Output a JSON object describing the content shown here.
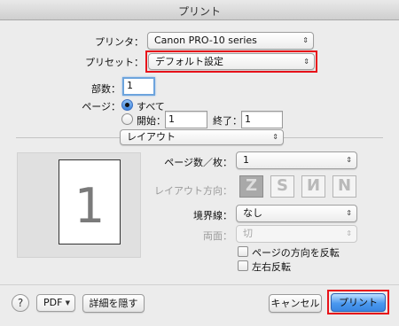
{
  "window": {
    "title": "プリント"
  },
  "printer": {
    "label": "プリンタ：",
    "value": "Canon PRO-10 series"
  },
  "preset": {
    "label": "プリセット：",
    "value": "デフォルト設定"
  },
  "copies": {
    "label": "部数：",
    "value": "1"
  },
  "pages": {
    "label": "ページ：",
    "all_label": "すべて",
    "from_label": "開始：",
    "from_value": "1",
    "to_label": "終了：",
    "to_value": "1",
    "selected": "all"
  },
  "section": {
    "value": "レイアウト"
  },
  "preview": {
    "page_number": "1"
  },
  "layout": {
    "pages_per_sheet_label": "ページ数／枚：",
    "pages_per_sheet_value": "1",
    "direction_label": "レイアウト方向：",
    "direction_options": [
      "Z",
      "S",
      "И",
      "N"
    ],
    "direction_selected_index": 0,
    "border_label": "境界線：",
    "border_value": "なし",
    "two_sided_label": "両面：",
    "two_sided_value": "切",
    "reverse_orientation_label": "ページの方向を反転",
    "flip_horizontal_label": "左右反転",
    "reverse_orientation_checked": false,
    "flip_horizontal_checked": false
  },
  "footer": {
    "help_label": "?",
    "pdf_label": "PDF",
    "hide_details_label": "詳細を隠す",
    "cancel_label": "キャンセル",
    "print_label": "プリント"
  },
  "colors": {
    "highlight": "#e8121a",
    "primary_button": "#4a98ef",
    "background": "#ececec"
  }
}
